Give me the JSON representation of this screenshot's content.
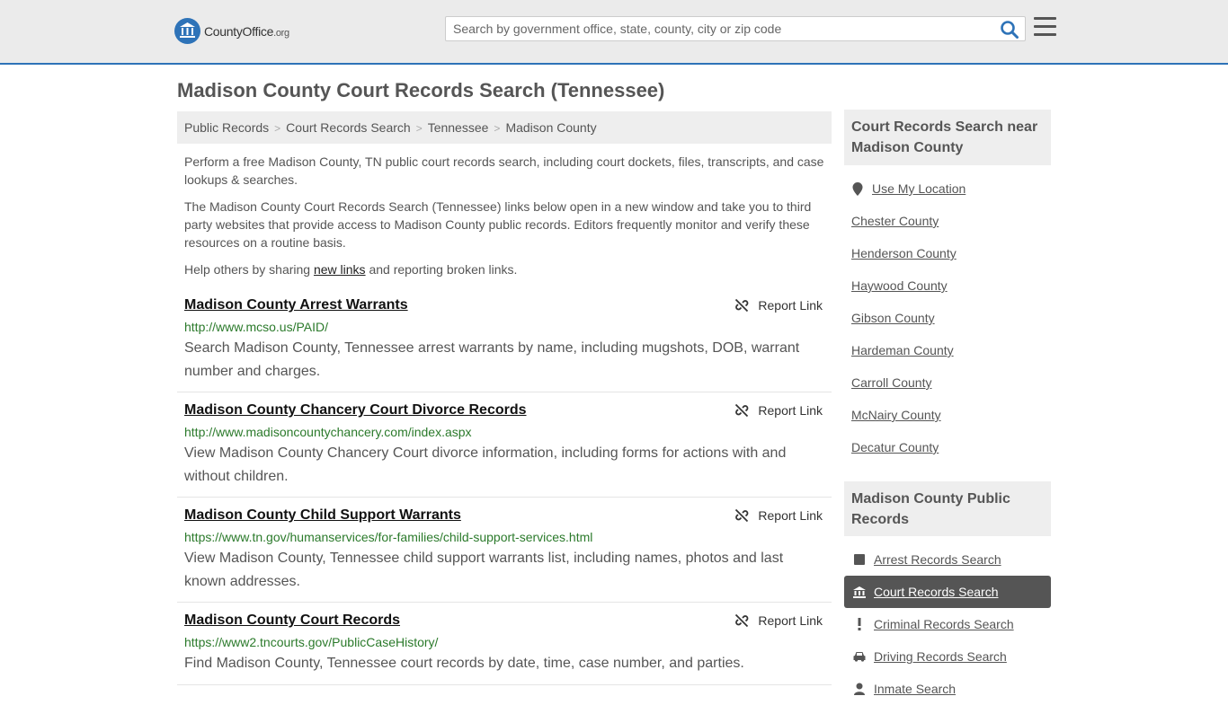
{
  "header": {
    "logo_text": "CountyOffice",
    "logo_suffix": ".org",
    "search_placeholder": "Search by government office, state, county, city or zip code"
  },
  "page_title": "Madison County Court Records Search (Tennessee)",
  "breadcrumb": [
    "Public Records",
    "Court Records Search",
    "Tennessee",
    "Madison County"
  ],
  "intro": {
    "p1": "Perform a free Madison County, TN public court records search, including court dockets, files, transcripts, and case lookups & searches.",
    "p2": "The Madison County Court Records Search (Tennessee) links below open in a new window and take you to third party websites that provide access to Madison County public records. Editors frequently monitor and verify these resources on a routine basis.",
    "p3_before": "Help others by sharing ",
    "p3_link": "new links",
    "p3_after": " and reporting broken links."
  },
  "report_label": "Report Link",
  "results": [
    {
      "title": "Madison County Arrest Warrants",
      "url": "http://www.mcso.us/PAID/",
      "desc": "Search Madison County, Tennessee arrest warrants by name, including mugshots, DOB, warrant number and charges."
    },
    {
      "title": "Madison County Chancery Court Divorce Records",
      "url": "http://www.madisoncountychancery.com/index.aspx",
      "desc": "View Madison County Chancery Court divorce information, including forms for actions with and without children."
    },
    {
      "title": "Madison County Child Support Warrants",
      "url": "https://www.tn.gov/humanservices/for-families/child-support-services.html",
      "desc": "View Madison County, Tennessee child support warrants list, including names, photos and last known addresses."
    },
    {
      "title": "Madison County Court Records",
      "url": "https://www2.tncourts.gov/PublicCaseHistory/",
      "desc": "Find Madison County, Tennessee court records by date, time, case number, and parties."
    }
  ],
  "sidebar": {
    "nearby_title": "Court Records Search near Madison County",
    "use_location": "Use My Location",
    "nearby": [
      "Chester County",
      "Henderson County",
      "Haywood County",
      "Gibson County",
      "Hardeman County",
      "Carroll County",
      "McNairy County",
      "Decatur County"
    ],
    "public_title": "Madison County Public Records",
    "public_items": [
      {
        "label": "Arrest Records Search",
        "icon": "square-icon"
      },
      {
        "label": "Court Records Search",
        "icon": "courthouse-icon"
      },
      {
        "label": "Criminal Records Search",
        "icon": "exclamation-icon"
      },
      {
        "label": "Driving Records Search",
        "icon": "car-icon"
      },
      {
        "label": "Inmate Search",
        "icon": "person-icon"
      }
    ]
  },
  "colors": {
    "accent": "#2e73b8",
    "url_green": "#2b7a2b",
    "active_bg": "#555555"
  }
}
